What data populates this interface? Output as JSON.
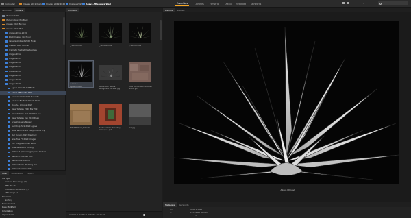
{
  "path": {
    "items": [
      {
        "label": "Computer"
      },
      {
        "label": "Images 2019 Main"
      },
      {
        "label": "Images 2019 2020"
      },
      {
        "label": "Images 2020"
      },
      {
        "label": "Agave Attenuata Wall"
      }
    ]
  },
  "workspaces": {
    "tabs": [
      "Essentials",
      "Libraries",
      "Filmstrip",
      "Output",
      "Metadata",
      "Keywords"
    ],
    "active": "Essentials",
    "sort": "Sort by Filename"
  },
  "left": {
    "tabs": [
      "Favorites",
      "Folders"
    ],
    "active_tab": "Folders",
    "folders": [
      {
        "label": "Macintosh HD",
        "kind": "grey"
      },
      {
        "label": "Memory Alley Pro Book",
        "kind": "orange"
      },
      {
        "label": "Images 2019 Backup",
        "kind": "orange"
      },
      {
        "label": "Images 2019 Main",
        "kind": "orange"
      },
      {
        "label": "Images 2012-2019",
        "kind": "blue"
      },
      {
        "label": "2020_Images (Archive)",
        "kind": "blue"
      },
      {
        "label": "Carvers Ambient 2020 Finals",
        "kind": "blue"
      },
      {
        "label": "Creative Elite HD Hart",
        "kind": "blue"
      },
      {
        "label": "Dramatic Portrait Masterclass",
        "kind": "blue"
      },
      {
        "label": "Images 2012",
        "kind": "blue"
      },
      {
        "label": "Images 2015",
        "kind": "blue"
      },
      {
        "label": "Images 2016",
        "kind": "blue"
      },
      {
        "label": "Images 2017",
        "kind": "blue"
      },
      {
        "label": "Images 2018",
        "kind": "blue"
      },
      {
        "label": "Images 2019",
        "kind": "blue"
      },
      {
        "label": "Images 2020",
        "kind": "blue"
      },
      {
        "label": "Images 2021",
        "kind": "blue"
      },
      {
        "label": "Agave TX with 1st Photo",
        "kind": "blue"
      },
      {
        "label": "Agave Attenuata Wall",
        "kind": "blue",
        "selected": true
      },
      {
        "label": "Botanical Kids 2020 Nov Site",
        "kind": "blue"
      },
      {
        "label": "Casa en Bonfanti March 2020",
        "kind": "blue"
      },
      {
        "label": "Cloudy - Arizona 2020",
        "kind": "blue"
      },
      {
        "label": "Desert Valley 2020 Bar Hat",
        "kind": "blue"
      },
      {
        "label": "Desert Valley Dez 2020 Ski Inn",
        "kind": "blue"
      },
      {
        "label": "Desert Valley Feb 2020 Deep",
        "kind": "blue"
      },
      {
        "label": "Grasshoppers Skater",
        "kind": "blue"
      },
      {
        "label": "Gumdrop Park 2020 Agave",
        "kind": "blue"
      },
      {
        "label": "Hotel Palm Grand Canyon River trip",
        "kind": "blue"
      },
      {
        "label": "Hull Tucson 2020 Elephant",
        "kind": "blue"
      },
      {
        "label": "Jade Tree FY 2020 Images",
        "kind": "blue"
      },
      {
        "label": "TXP Images CA Dez 2020",
        "kind": "blue"
      },
      {
        "label": "Lone Tree Sand Dunings",
        "kind": "blue"
      },
      {
        "label": "Nathan & James Aggregated Nichols",
        "kind": "blue"
      },
      {
        "label": "Nathan C72 2020 Tour",
        "kind": "blue"
      },
      {
        "label": "Nathan Marsh Land",
        "kind": "blue"
      },
      {
        "label": "Nathan Parks Wedding Tele",
        "kind": "blue"
      },
      {
        "label": "Nathan Summer 2019",
        "kind": "blue"
      },
      {
        "label": "Nathan Roundups",
        "kind": "blue"
      }
    ],
    "filter": {
      "tabs": [
        "Filter",
        "Collections",
        "Export"
      ],
      "active_tab": "Filter",
      "rows": [
        {
          "label": "File Type",
          "group": true
        },
        {
          "label": "Camera Raw image (1)",
          "group": false
        },
        {
          "label": "JPEG file (1)",
          "group": false
        },
        {
          "label": "Photoshop document (1)",
          "group": false
        },
        {
          "label": "TIFF image (1)",
          "group": false
        },
        {
          "label": "Keywords",
          "group": true
        },
        {
          "label": "Nothing",
          "group": false
        },
        {
          "label": "Date Created",
          "group": true
        },
        {
          "label": "Date Modified",
          "group": true
        },
        {
          "label": "Orientation",
          "group": true
        },
        {
          "label": "Aspect Ratio",
          "group": true
        }
      ]
    }
  },
  "content": {
    "tab": "Content",
    "items": [
      {
        "caption": "_7MD3928.CR2"
      },
      {
        "caption": "_7MD3929.CR2"
      },
      {
        "caption": "_7MD3930.CR2"
      },
      {
        "caption": "Agave 009.psd"
      },
      {
        "caption": "Agave With Texture Background 0174567.jpg"
      },
      {
        "caption": "2014 Monder Wall 2108.psd (2018) gel"
      },
      {
        "caption": "MISSION WALL_2016.CR"
      },
      {
        "caption": "Santa Catalina Monastery Arequipa 4.psd"
      },
      {
        "caption": "Tint.jpg"
      }
    ],
    "footer": "9 items, 1 hidden, 1 selected - 30.13 MB"
  },
  "preview": {
    "tabs": [
      "Preview",
      "Publish"
    ],
    "active_tab": "Preview",
    "caption": "Agave 009.psd"
  },
  "metadata": {
    "tabs": [
      "Metadata",
      "Keywords"
    ],
    "active_tab": "Metadata",
    "rows": [
      {
        "a": "f/—",
        "b": "4781 × 3888"
      },
      {
        "a": "—",
        "b": "135.44 MB   300 ppi"
      },
      {
        "a": "ISO —",
        "b": "Untagged   RGB"
      }
    ]
  },
  "colors": {
    "accent": "#f5a623",
    "folder_blue": "#3d7fd6",
    "selection": "#3c4656"
  }
}
